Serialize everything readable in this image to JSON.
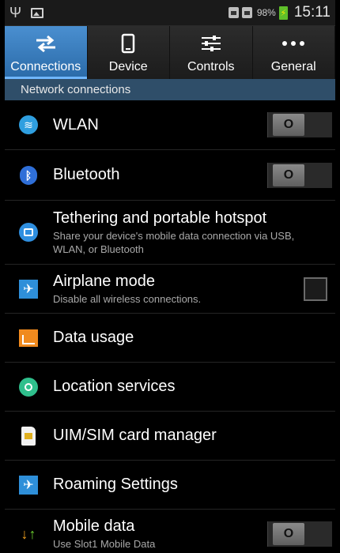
{
  "status_bar": {
    "battery_percent": "98%",
    "time": "15:11",
    "icons": [
      "usb-icon",
      "gallery-icon",
      "sim1-icon",
      "sim2-icon",
      "battery-charging-icon"
    ]
  },
  "tabs": [
    {
      "label": "Connections",
      "icon": "connections-icon",
      "active": true
    },
    {
      "label": "Device",
      "icon": "device-icon",
      "active": false
    },
    {
      "label": "Controls",
      "icon": "controls-icon",
      "active": false
    },
    {
      "label": "General",
      "icon": "more-icon",
      "active": false
    }
  ],
  "section_header": "Network connections",
  "items": [
    {
      "title": "WLAN",
      "subtitle": "",
      "icon": "wifi-icon",
      "control": "toggle",
      "toggle_label": "O",
      "on": false
    },
    {
      "title": "Bluetooth",
      "subtitle": "",
      "icon": "bluetooth-icon",
      "control": "toggle",
      "toggle_label": "O",
      "on": false
    },
    {
      "title": "Tethering and portable hotspot",
      "subtitle": "Share your device's mobile data connection via USB, WLAN, or Bluetooth",
      "icon": "tethering-icon",
      "control": "none"
    },
    {
      "title": "Airplane mode",
      "subtitle": "Disable all wireless connections.",
      "icon": "airplane-icon",
      "control": "checkbox",
      "checked": false
    },
    {
      "title": "Data usage",
      "subtitle": "",
      "icon": "data-usage-icon",
      "control": "none"
    },
    {
      "title": "Location services",
      "subtitle": "",
      "icon": "location-icon",
      "control": "none"
    },
    {
      "title": "UIM/SIM card manager",
      "subtitle": "",
      "icon": "sim-card-icon",
      "control": "none"
    },
    {
      "title": "Roaming Settings",
      "subtitle": "",
      "icon": "roaming-icon",
      "control": "none"
    },
    {
      "title": "Mobile data",
      "subtitle": "Use Slot1 Mobile Data",
      "icon": "mobile-data-icon",
      "control": "toggle",
      "toggle_label": "O",
      "on": false
    }
  ],
  "colors": {
    "active_tab": "#3f86c9",
    "section_header_bg": "#2f4e69",
    "background": "#000000"
  }
}
